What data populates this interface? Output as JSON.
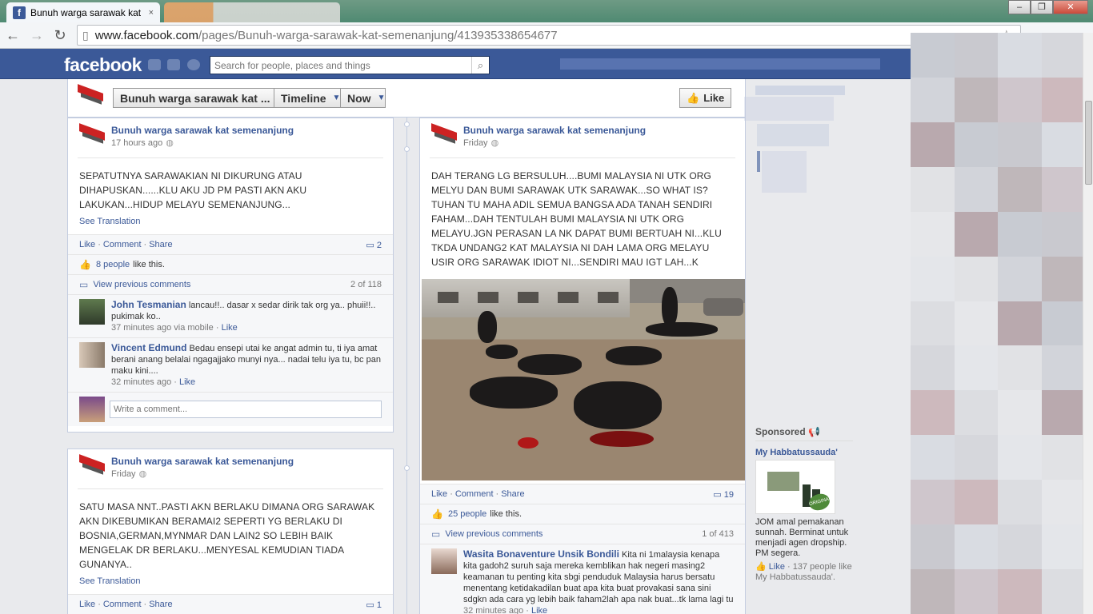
{
  "browser": {
    "tab_title": "Bunuh warga sarawak kat",
    "tab_close": "×",
    "url_host": "www.facebook.com",
    "url_path": "/pages/Bunuh-warga-sarawak-kat-semenanjung/413935338654677"
  },
  "fb": {
    "logo": "facebook",
    "search_placeholder": "Search for people, places and things"
  },
  "page_header": {
    "page_select": "Bunuh warga sarawak kat ...",
    "timeline_select": "Timeline",
    "now_select": "Now",
    "like_button": "Like"
  },
  "posts": [
    {
      "author": "Bunuh warga sarawak kat semenanjung",
      "time": "17 hours ago",
      "text": "SEPATUTNYA SARAWAKIAN NI DIKURUNG ATAU DIHAPUSKAN......KLU AKU JD PM PASTI AKN AKU LAKUKAN...HIDUP MELAYU SEMENANJUNG...",
      "see_translation": "See Translation",
      "action_like": "Like",
      "action_comment": "Comment",
      "action_share": "Share",
      "comment_count": "2",
      "likes_link": "8 people",
      "likes_suffix": "like this.",
      "view_previous": "View previous comments",
      "comment_range": "2 of 118",
      "comments": [
        {
          "name": "John Tesmanian",
          "text": "lancau!!.. dasar x sedar dirik tak org ya.. phuii!!.. pukimak ko..",
          "meta": "37 minutes ago via mobile",
          "like": "Like"
        },
        {
          "name": "Vincent Edmund",
          "text": "Bedau ensepi utai ke angat admin tu, ti iya amat berani anang belalai ngagajjako munyi nya... nadai telu iya tu, bc pan maku kini....",
          "meta": "32 minutes ago",
          "like": "Like"
        }
      ],
      "write_placeholder": "Write a comment..."
    },
    {
      "author": "Bunuh warga sarawak kat semenanjung",
      "time": "Friday",
      "text": "SATU MASA NNT..PASTI AKN BERLAKU DIMANA ORG SARAWAK AKN DIKEBUMIKAN BERAMAI2 SEPERTI YG BERLAKU DI BOSNIA,GERMAN,MYNMAR DAN LAIN2 SO LEBIH BAIK MENGELAK DR BERLAKU...MENYESAL KEMUDIAN TIADA GUNANYA..",
      "see_translation": "See Translation",
      "action_like": "Like",
      "action_comment": "Comment",
      "action_share": "Share",
      "comment_count": "1"
    },
    {
      "author": "Bunuh warga sarawak kat semenanjung",
      "time": "Friday",
      "text": "DAH TERANG LG BERSULUH....BUMI MALAYSIA NI UTK ORG MELYU DAN BUMI SARAWAK UTK SARAWAK...SO WHAT IS? TUHAN TU MAHA ADIL SEMUA BANGSA ADA TANAH SENDIRI FAHAM...DAH TENTULAH BUMI MALAYSIA NI UTK ORG MELAYU.JGN PERASAN LA NK DAPAT BUMI BERTUAH NI...KLU TKDA UNDANG2 KAT MALAYSIA NI DAH LAMA ORG MELAYU USIR ORG SARAWAK IDIOT NI...SENDIRI MAU IGT LAH...K",
      "action_like": "Like",
      "action_comment": "Comment",
      "action_share": "Share",
      "comment_count": "19",
      "likes_link": "25 people",
      "likes_suffix": "like this.",
      "view_previous": "View previous comments",
      "comment_range": "1 of 413",
      "comments": [
        {
          "name": "Wasita Bonaventure Unsik Bondili",
          "text": "Kita ni 1malaysia kenapa kita gadoh2 suruh saja mereka kemblikan hak negeri masing2 keamanan tu penting kita sbgi penduduk Malaysia harus bersatu menentang ketidakadilan buat apa kita buat provakasi sana sini sdgkn ada cara yg lebih baik faham2lah apa nak buat...tk lama lagi tu",
          "meta": "32 minutes ago",
          "like": "Like"
        }
      ]
    }
  ],
  "sponsored": {
    "title": "Sponsored",
    "ad_title": "My Habbatussauda'",
    "ad_text": "JOM amal pemakanan sunnah. Berminat untuk menjadi agen dropship. PM segera.",
    "ad_like": "Like",
    "ad_like_suffix": "137 people like My Habbatussauda'.",
    "ad_seal": "ORIGINAL"
  },
  "colors": {
    "fb_blue": "#3b5998",
    "link": "#3b5998",
    "page_bg": "#e9eaed"
  }
}
